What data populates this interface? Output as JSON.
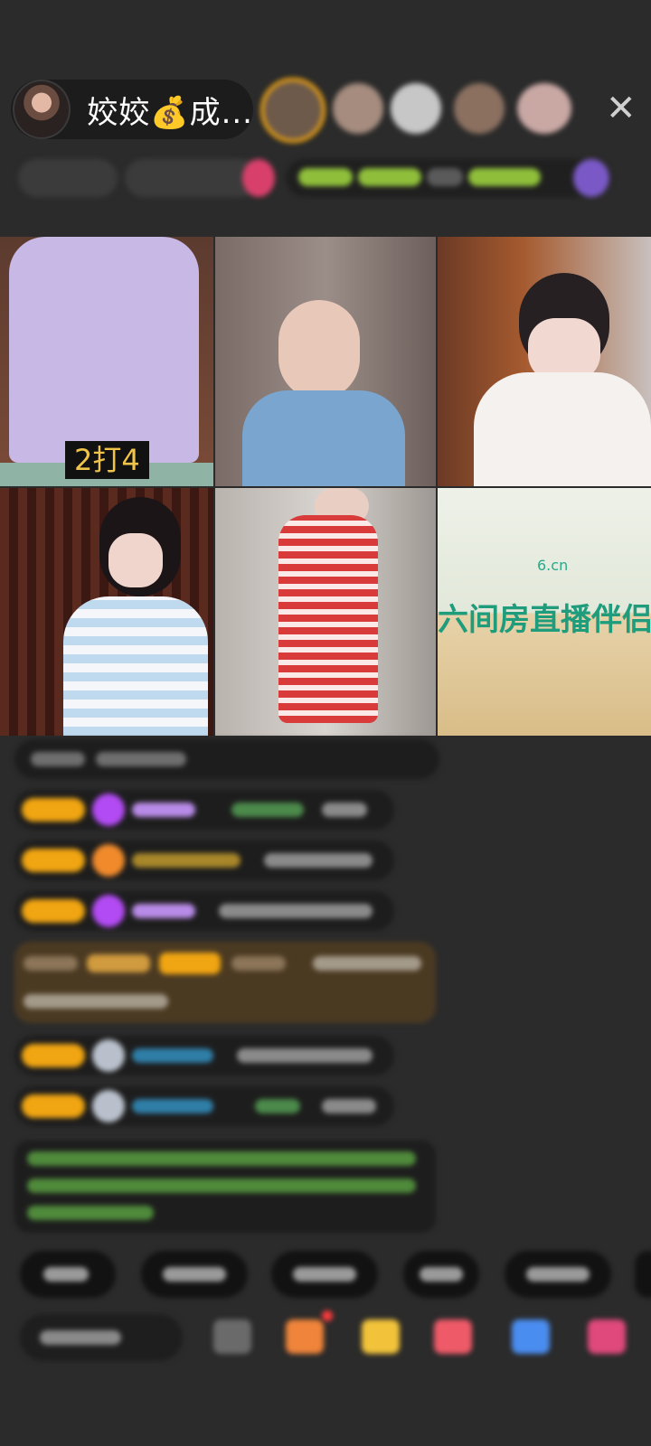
{
  "host": {
    "name": "姣姣💰成..."
  },
  "icons": {
    "close": "close-icon",
    "avatar": "host-avatar"
  },
  "grid": {
    "cells": [
      {
        "overlay_text": "2打4",
        "corner_caption": ""
      },
      {
        "overlay_text": "",
        "corner_caption": ""
      },
      {
        "overlay_text": "",
        "corner_caption": ""
      },
      {
        "overlay_text": "",
        "corner_caption": ""
      },
      {
        "overlay_text": "",
        "corner_caption": ""
      },
      {
        "overlay_text": "六间房直播伴侣",
        "corner_caption": "6.cn"
      }
    ]
  },
  "colors": {
    "background": "#2b2b2b",
    "badge": "#f0a512",
    "gift_purple": "#b24bf3",
    "brand_teal": "#1e9c7c"
  }
}
